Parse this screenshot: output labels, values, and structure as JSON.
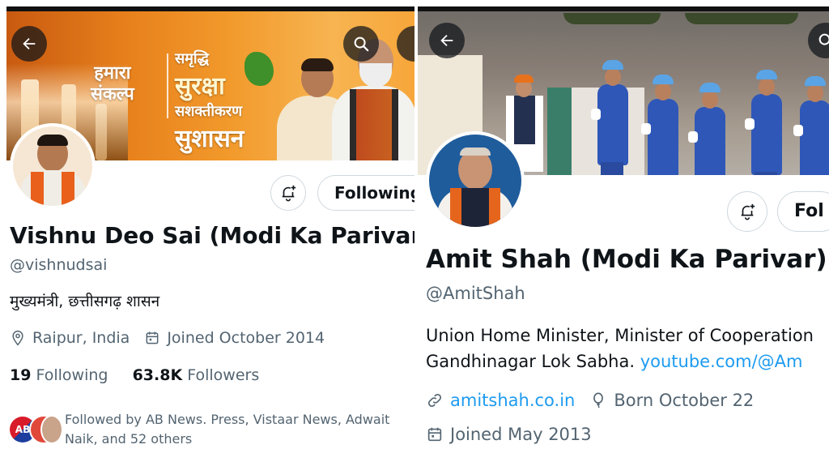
{
  "left_profile": {
    "banner": {
      "line1": "हमारा",
      "line2": "संकल्प",
      "line3": "समृद्धि",
      "line4": "सुरक्षा",
      "line5": "सशक्तीकरण",
      "line6": "सुशासन"
    },
    "follow_label": "Following",
    "name": "Vishnu Deo Sai (Modi Ka Parivar)",
    "handle": "@vishnudsai",
    "bio": "मुख्यमंत्री, छत्तीसगढ़ शासन",
    "location": "Raipur, India",
    "joined": "Joined October 2014",
    "following_count": "19",
    "following_label": "Following",
    "followers_count": "63.8K",
    "followers_label": "Followers",
    "followed_by_line1": "Followed by AB News. Press, Vistaar News, Adwait",
    "followed_by_line2": "Naik, and 52 others",
    "followed_avatar_text": "AB"
  },
  "right_profile": {
    "follow_label": "Fol",
    "name": "Amit Shah (Modi Ka Parivar)",
    "handle": "@AmitShah",
    "bio_line1": "Union Home Minister, Minister of Cooperation",
    "bio_line2_text": "Gandhinagar Lok Sabha.",
    "bio_line2_link": "youtube.com/@Am",
    "website": "amitshah.co.in",
    "born": "Born October 22",
    "joined": "Joined May 2013"
  },
  "icons": {
    "back": "arrow-left-icon",
    "search": "search-icon",
    "bell": "bell-plus-icon",
    "location": "location-pin-icon",
    "calendar": "calendar-icon",
    "link": "link-icon",
    "balloon": "balloon-icon"
  },
  "colors": {
    "primary_text": "#0f1419",
    "secondary_text": "#536471",
    "link": "#1d9bf0",
    "border": "#cfd9de"
  }
}
